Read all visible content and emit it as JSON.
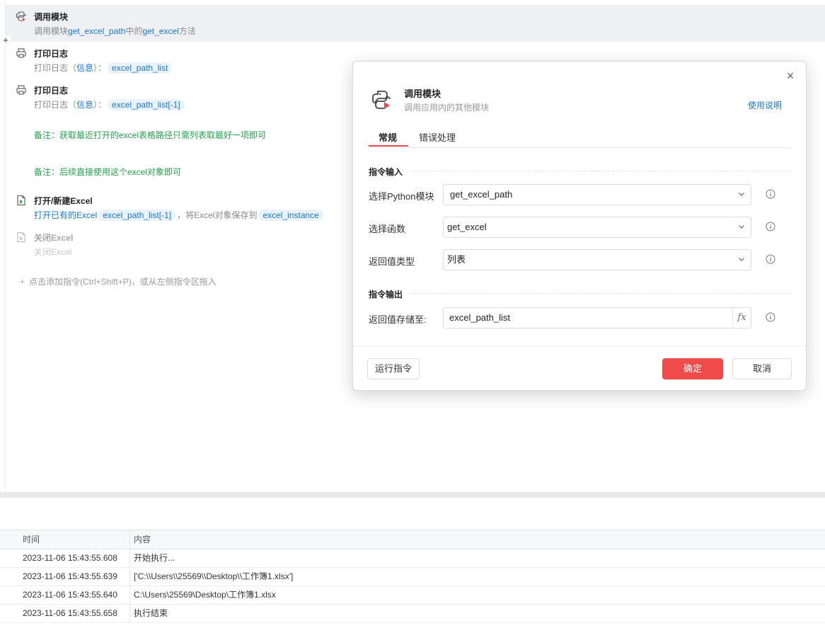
{
  "steps": [
    {
      "title": "调用模块",
      "desc_parts": [
        "调用模块",
        "get_excel_path",
        "中的",
        "get_excel",
        "方法"
      ],
      "icon": "python-module-icon"
    },
    {
      "title": "打印日志",
      "desc_prefix": "打印日志（",
      "level": "信息",
      "desc_mid": "）：",
      "var": "excel_path_list",
      "icon": "printer-icon"
    },
    {
      "title": "打印日志",
      "desc_prefix": "打印日志（",
      "level": "信息",
      "desc_mid": "）：",
      "var": "excel_path_list[-1]",
      "icon": "printer-icon"
    },
    {
      "title": "打开/新建Excel",
      "desc_a": "打开已有的Excel",
      "var1": "excel_path_list[-1]",
      "desc_b": "，将Excel对象保存到",
      "var2": "excel_instance",
      "icon": "excel-icon"
    },
    {
      "title": "关闭Excel",
      "desc": "关闭Excel",
      "icon": "excel-close-icon"
    }
  ],
  "notes": [
    "备注：获取最近打开的excel表格路径只需列表取最好一项即可",
    "备注：后续直接使用这个excel对象即可"
  ],
  "add_hint": "点击添加指令(Ctrl+Shift+P)，或从左侧指令区拖入",
  "add_plus": "+",
  "log": {
    "headers": {
      "time": "时间",
      "content": "内容"
    },
    "rows": [
      {
        "time": "2023-11-06 15:43:55.608",
        "content": "开始执行..."
      },
      {
        "time": "2023-11-06 15:43:55.639",
        "content": "['C:\\\\Users\\\\25569\\\\Desktop\\\\工作簿1.xlsx']"
      },
      {
        "time": "2023-11-06 15:43:55.640",
        "content": "C:\\Users\\25569\\Desktop\\工作簿1.xlsx"
      },
      {
        "time": "2023-11-06 15:43:55.658",
        "content": "执行结束"
      }
    ]
  },
  "dialog": {
    "title": "调用模块",
    "subtitle": "调用应用内的其他模块",
    "help": "使用说明",
    "close": "×",
    "tabs": [
      "常规",
      "错误处理"
    ],
    "active_tab": "常规",
    "section_input": "指令输入",
    "section_output": "指令输出",
    "fields": {
      "module_label": "选择Python模块",
      "module_value": "get_excel_path",
      "function_label": "选择函数",
      "function_value": "get_excel",
      "return_type_label": "返回值类型",
      "return_type_value": "列表",
      "save_to_label": "返回值存储至:",
      "save_to_value": "excel_path_list",
      "fx": "fx"
    },
    "buttons": {
      "run": "运行指令",
      "ok": "确定",
      "cancel": "取消"
    },
    "colors": {
      "accent": "#f04b4b",
      "link": "#1677d9"
    }
  }
}
